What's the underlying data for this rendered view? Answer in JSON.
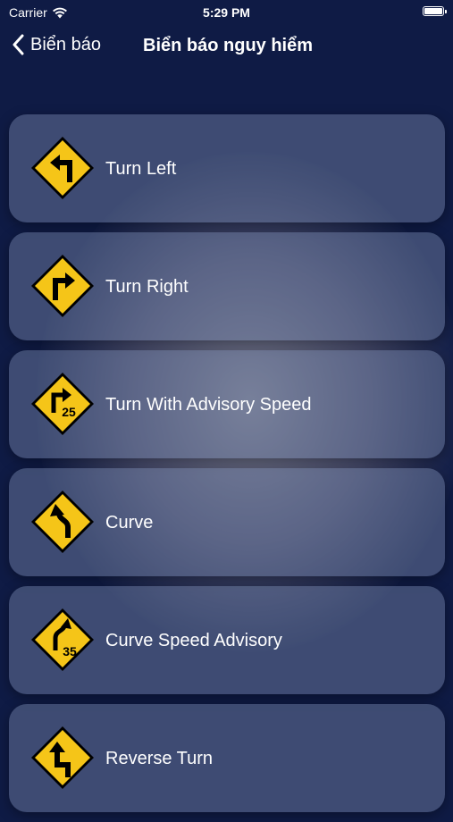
{
  "status_bar": {
    "carrier": "Carrier",
    "time": "5:29 PM",
    "battery_level": 1.0
  },
  "nav": {
    "back_label": "Biển báo",
    "title": "Biển báo nguy hiểm"
  },
  "colors": {
    "background": "#0f1b45",
    "sign_yellow": "#f5c518",
    "card": "#7887aa"
  },
  "signs": [
    {
      "label": "Turn Left",
      "icon": "turn-left-sign-icon"
    },
    {
      "label": "Turn Right",
      "icon": "turn-right-sign-icon"
    },
    {
      "label": "Turn With Advisory Speed",
      "icon": "turn-advisory-speed-sign-icon",
      "speed": "25"
    },
    {
      "label": "Curve",
      "icon": "curve-sign-icon"
    },
    {
      "label": "Curve Speed Advisory",
      "icon": "curve-speed-advisory-sign-icon",
      "speed": "35"
    },
    {
      "label": "Reverse Turn",
      "icon": "reverse-turn-sign-icon"
    }
  ]
}
